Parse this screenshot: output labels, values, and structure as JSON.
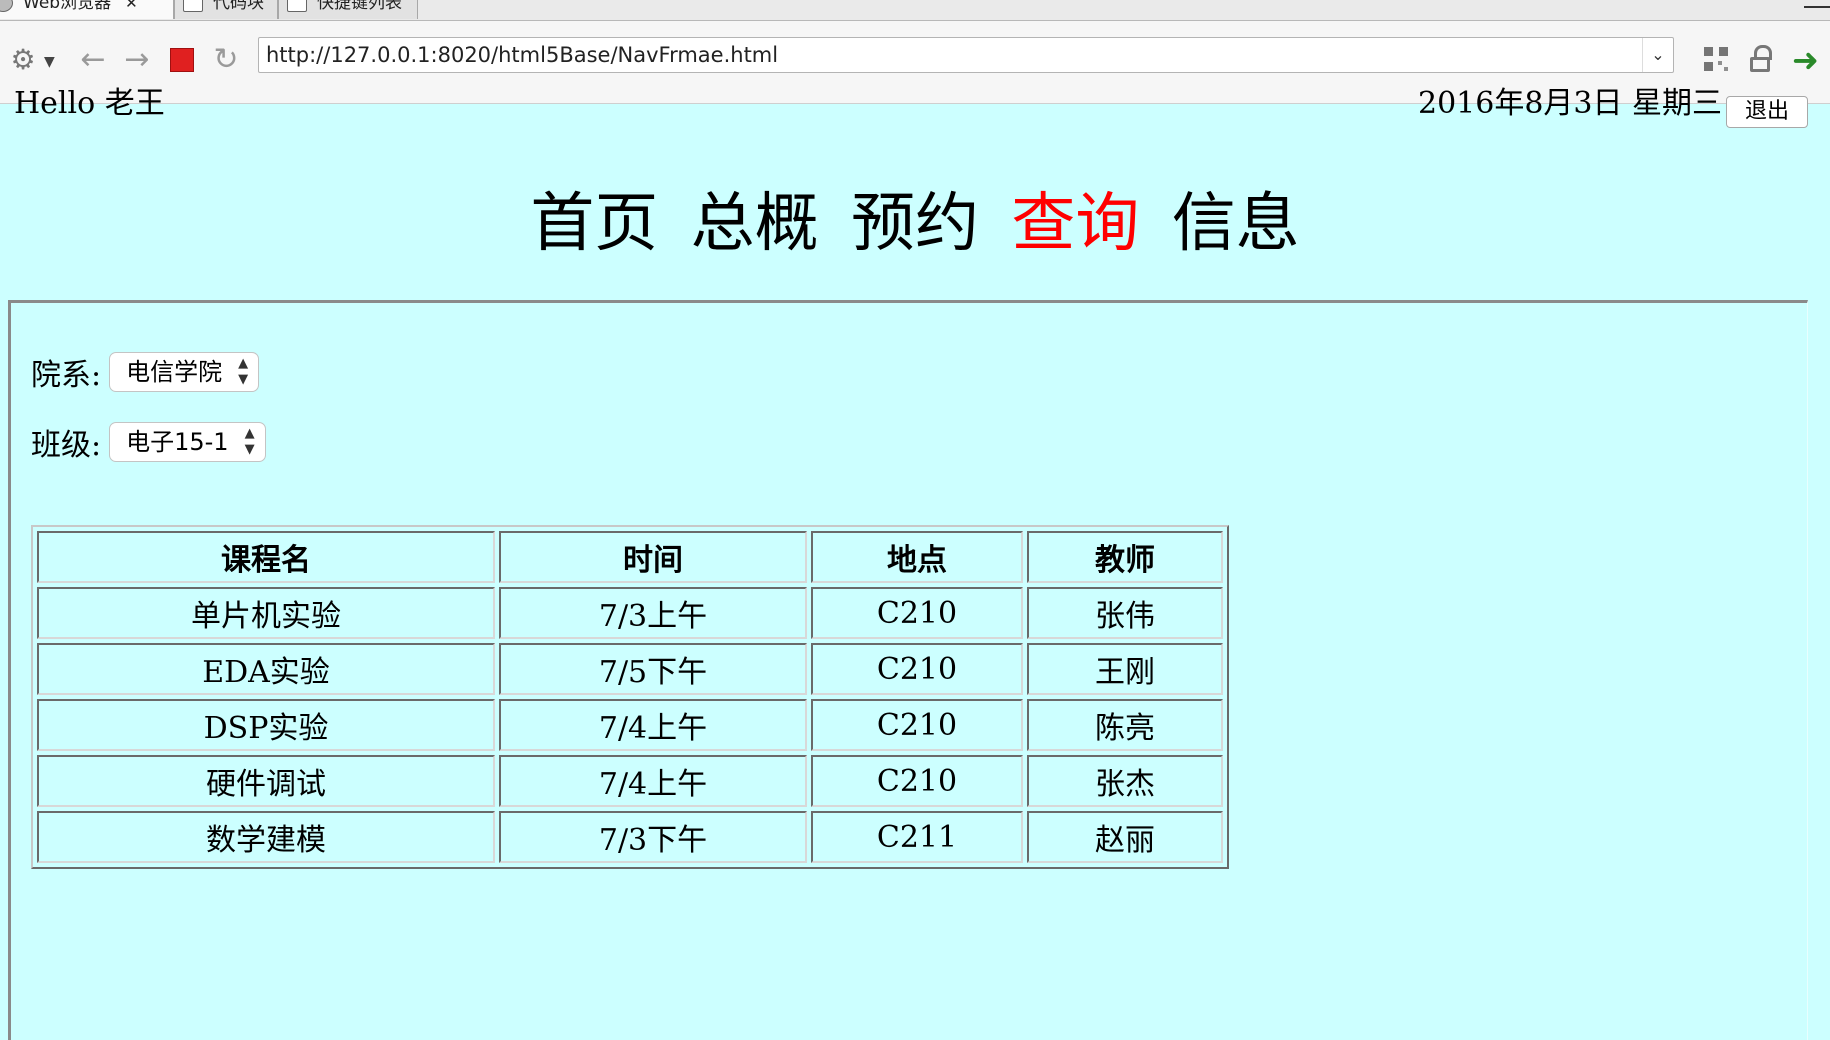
{
  "browser": {
    "tabs": [
      {
        "label": "Web浏览器",
        "active": true
      },
      {
        "label": "代码块",
        "active": false
      },
      {
        "label": "快捷键列表",
        "active": false
      }
    ],
    "url": "http://127.0.0.1:8020/html5Base/NavFrmae.html",
    "icons": [
      "gear-icon",
      "caret-down-icon",
      "back-arrow-icon",
      "forward-arrow-icon",
      "stop-icon",
      "reload-icon",
      "dropdown-chevron-icon",
      "qr-code-icon",
      "lock-icon",
      "go-arrow-icon"
    ]
  },
  "header": {
    "greeting": "Hello 老王",
    "date": "2016年8月3日 星期三",
    "logout_label": "退出"
  },
  "nav": {
    "items": [
      {
        "label": "首页",
        "active": false
      },
      {
        "label": "总概",
        "active": false
      },
      {
        "label": "预约",
        "active": false
      },
      {
        "label": "查询",
        "active": true
      },
      {
        "label": "信息",
        "active": false
      }
    ],
    "active_color": "#ff0000"
  },
  "filters": {
    "department": {
      "label": "院系:",
      "value": "电信学院"
    },
    "class": {
      "label": "班级:",
      "value": "电子15-1"
    }
  },
  "table": {
    "headers": [
      "课程名",
      "时间",
      "地点",
      "教师"
    ],
    "rows": [
      [
        "单片机实验",
        "7/3上午",
        "C210",
        "张伟"
      ],
      [
        "EDA实验",
        "7/5下午",
        "C210",
        "王刚"
      ],
      [
        "DSP实验",
        "7/4上午",
        "C210",
        "陈亮"
      ],
      [
        "硬件调试",
        "7/4上午",
        "C210",
        "张杰"
      ],
      [
        "数学建模",
        "7/3下午",
        "C211",
        "赵丽"
      ]
    ]
  },
  "colors": {
    "page_background": "#ccffff",
    "stop_button": "#e02020",
    "go_arrow": "#2a8a2a"
  }
}
